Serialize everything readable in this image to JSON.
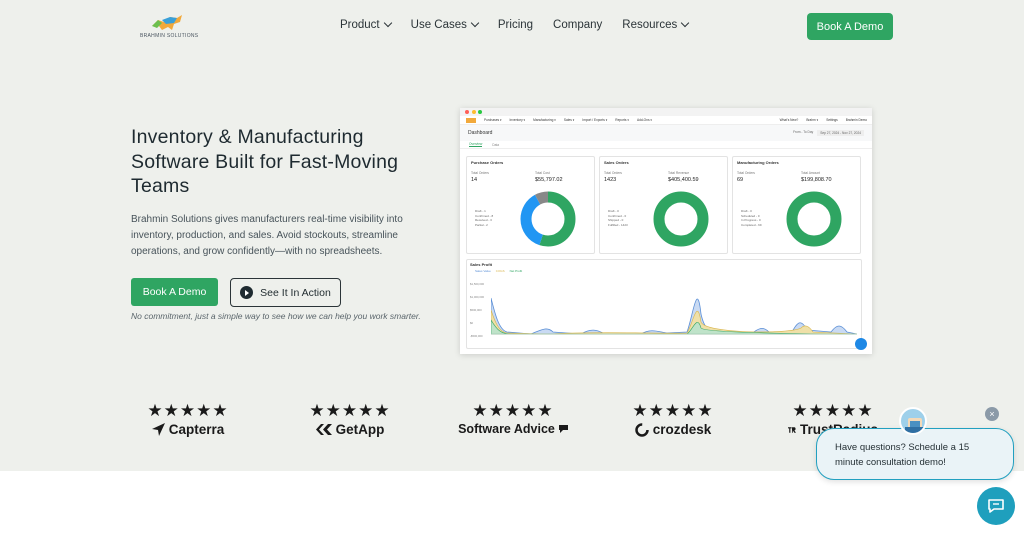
{
  "header": {
    "logo_text": "BRAHMIN SOLUTIONS",
    "nav": [
      {
        "label": "Product",
        "dropdown": true
      },
      {
        "label": "Use Cases",
        "dropdown": true
      },
      {
        "label": "Pricing",
        "dropdown": false
      },
      {
        "label": "Company",
        "dropdown": false
      },
      {
        "label": "Resources",
        "dropdown": true
      }
    ],
    "cta_label": "Book A Demo"
  },
  "hero": {
    "title": "Inventory & Manufacturing Software Built for Fast-Moving Teams",
    "description": "Brahmin Solutions gives manufacturers real-time visibility into inventory, production, and sales. Avoid stockouts, streamline operations, and grow confidently—with no spreadsheets.",
    "primary_button": "Book A Demo",
    "secondary_button": "See It In Action",
    "note": "No commitment, just a simple way to see how we can help you work smarter."
  },
  "dashboard": {
    "nav_items": [
      "Purchases ▾",
      "Inventory ▾",
      "Manufacturing ▾",
      "Sales ▾",
      "Import / Exports ▾",
      "Reports ▾",
      "Add-Ons ▾"
    ],
    "nav_right": [
      "What's New?",
      "Brahm ▾",
      "Settings",
      "Brahmin Demo"
    ],
    "title": "Dashboard",
    "date_filter": [
      "From - To Day",
      "Sep 27, 2024 - Nov 27, 2024"
    ],
    "tabs": [
      "Overview",
      "Data"
    ],
    "cards": [
      {
        "title": "Purchase Orders",
        "count_label": "Total Orders",
        "count": "14",
        "amount_label": "Total Cost",
        "amount": "$55,797.02",
        "legend": [
          "Draft - 1",
          "Confirmed - 8",
          "Received - 3",
          "Partial - 2"
        ],
        "segments": [
          {
            "value": 0.55,
            "color": "#2fa562"
          },
          {
            "value": 0.37,
            "color": "#2196f3"
          },
          {
            "value": 0.08,
            "color": "#888888"
          }
        ]
      },
      {
        "title": "Sales Orders",
        "count_label": "Total Orders",
        "count": "1423",
        "amount_label": "Total Revenue",
        "amount": "$405,400.59",
        "legend": [
          "Draft - 0",
          "Confirmed - 0",
          "Shipped - 0",
          "Fulfilled - 1423"
        ],
        "segments": [
          {
            "value": 1.0,
            "color": "#2fa562"
          }
        ]
      },
      {
        "title": "Manufacturing Orders",
        "count_label": "Total Orders",
        "count": "69",
        "amount_label": "Total Amount",
        "amount": "$199,808.70",
        "legend": [
          "Draft - 0",
          "Scheduled - 0",
          "In Progress - 0",
          "Completed - 69"
        ],
        "segments": [
          {
            "value": 1.0,
            "color": "#2fa562"
          }
        ]
      }
    ],
    "profit": {
      "title": "Sales Profit",
      "legend": [
        "Sales Value",
        "COGS",
        "Net Profit"
      ],
      "y_ticks": [
        "$1,500,000",
        "$1,000,000",
        "$500,000",
        "$0",
        "-$500,000"
      ]
    }
  },
  "reviews": [
    {
      "stars": "★★★★★",
      "brand": "Capterra",
      "icon": "capterra-arrow-icon"
    },
    {
      "stars": "★★★★★",
      "brand": "GetApp",
      "icon": "getapp-chevrons-icon"
    },
    {
      "stars": "★★★★★",
      "brand": "Software Advice",
      "icon": "software-advice-bubble-icon"
    },
    {
      "stars": "★★★★★",
      "brand": "crozdesk",
      "icon": "crozdesk-c-icon"
    },
    {
      "stars": "★★★★★",
      "brand": "TrustRadius",
      "icon": "trustradius-tr-icon"
    }
  ],
  "chat": {
    "message": "Have questions? Schedule a 15 minute consultation demo!",
    "close_symbol": "×"
  },
  "colors": {
    "accent": "#2fa562",
    "hero_bg": "#eef0ec",
    "chat_accent": "#1f9fbd"
  }
}
